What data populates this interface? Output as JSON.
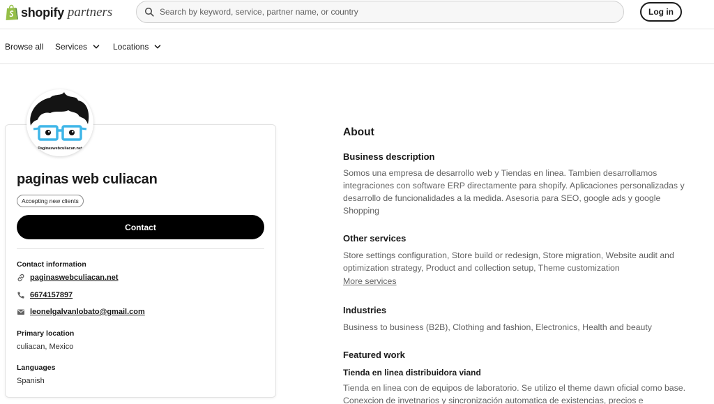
{
  "header": {
    "logo_brand": "shopify",
    "logo_suffix": "partners",
    "search_placeholder": "Search by keyword, service, partner name, or country",
    "login_label": "Log in"
  },
  "nav": {
    "browse_all": "Browse all",
    "services": "Services",
    "locations": "Locations"
  },
  "profile": {
    "avatar_caption": "Paginaswebculiacan.net",
    "name": "paginas web culiacan",
    "badge": "Accepting new clients",
    "contact_button": "Contact",
    "contact_info_label": "Contact information",
    "website": "paginaswebculiacan.net",
    "phone": "6674157897",
    "email": "leonelgalvanlobato@gmail.com",
    "primary_location_label": "Primary location",
    "primary_location": "culiacan, Mexico",
    "languages_label": "Languages",
    "languages": "Spanish"
  },
  "about": {
    "title": "About",
    "business_description_heading": "Business description",
    "business_description": "Somos una empresa de desarrollo web y Tiendas en linea. Tambien desarrollamos integraciones con software ERP directamente para shopify. Aplicaciones personalizadas y desarrollo de funcionalidades a la medida.  Asesoria para SEO, google ads y google Shopping",
    "other_services_heading": "Other services",
    "other_services": "Store settings configuration, Store build or redesign, Store migration, Website audit and optimization strategy, Product and collection setup, Theme customization",
    "more_services": "More services",
    "industries_heading": "Industries",
    "industries": "Business to business (B2B), Clothing and fashion, Electronics, Health and beauty",
    "featured_work_heading": "Featured work",
    "featured_work_title": "Tienda en linea distribuidora viand",
    "featured_work_description": "Tienda en linea con de equipos de laboratorio. Se utilizo el theme dawn oficial como base. Conexcion de invetnarios y sincronización automatica de existencias, precios e"
  },
  "colors": {
    "brand_green": "#95bf47",
    "brand_green_dark": "#5e8e3e",
    "text_primary": "#1a1a1a",
    "text_secondary": "#616161",
    "button_dark": "#000000",
    "glasses_blue": "#3fb6e8"
  },
  "icons": {
    "logo": "shopify-bag-icon",
    "search": "search-icon",
    "chevron": "chevron-down-icon",
    "website": "link-icon",
    "phone": "phone-icon",
    "email": "mail-icon"
  }
}
